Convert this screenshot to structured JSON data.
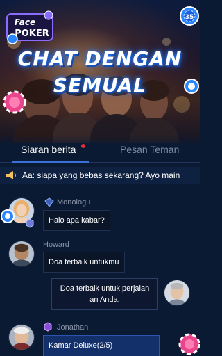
{
  "banner": {
    "logo_line1": "Face",
    "logo_line2": "POKER",
    "headline_line1": "CHAT DENGAN",
    "headline_line2": "SEMUAL",
    "chip_label": "35"
  },
  "tabs": [
    {
      "label": "Siaran berita",
      "active": true
    },
    {
      "label": "Pesan Teman",
      "active": false
    }
  ],
  "announcement": {
    "icon": "megaphone-icon",
    "text": "Aa: siapa yang bebas sekarang? Ayo main"
  },
  "messages": [
    {
      "user": "Monologu",
      "text": "Halo apa kabar?",
      "side": "left"
    },
    {
      "user": "Howard",
      "text": "Doa terbaik untukmu",
      "side": "left"
    },
    {
      "user": "",
      "text_line1": "Doa terbaik untuk perjalan",
      "text_line2": "an Anda.",
      "side": "right"
    },
    {
      "user": "Jonathan",
      "text": "Kamar Deluxe(2/5)",
      "side": "left"
    }
  ],
  "colors": {
    "background": "#0b1a33",
    "accent_blue": "#3a6fd8",
    "notification_dot": "#e0303b",
    "chip_pink": "#e8458c",
    "chip_blue": "#2a86ff"
  }
}
